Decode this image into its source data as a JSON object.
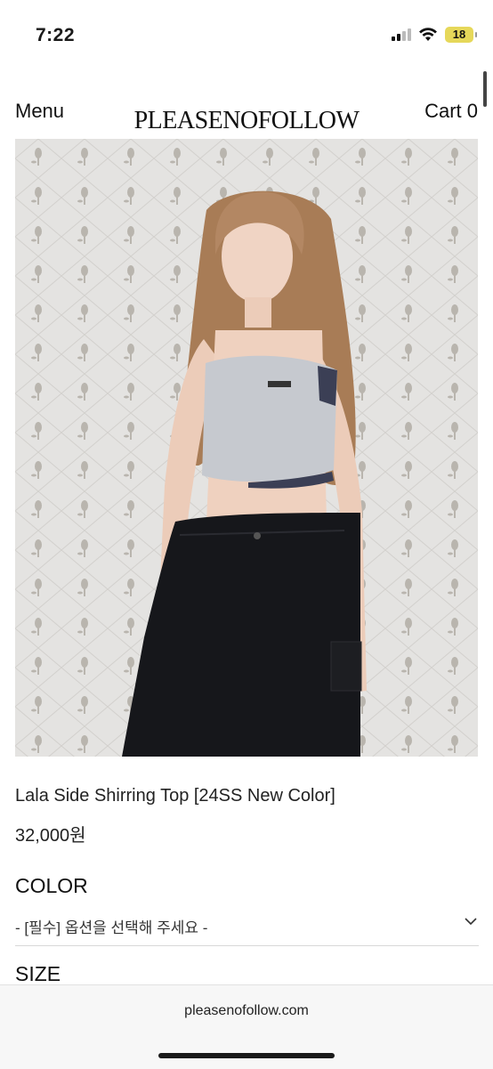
{
  "status_bar": {
    "time": "7:22",
    "battery": "18"
  },
  "header": {
    "menu_label": "Menu",
    "logo": "PLEASENOFOLLOW",
    "cart_label": "Cart 0"
  },
  "product": {
    "name": "Lala Side Shirring Top [24SS New Color]",
    "price": "32,000원"
  },
  "options": {
    "color_label": "COLOR",
    "color_placeholder": "- [필수] 옵션을 선택해 주세요 -",
    "size_label": "SIZE"
  },
  "browser": {
    "url": "pleasenofollow.com"
  }
}
